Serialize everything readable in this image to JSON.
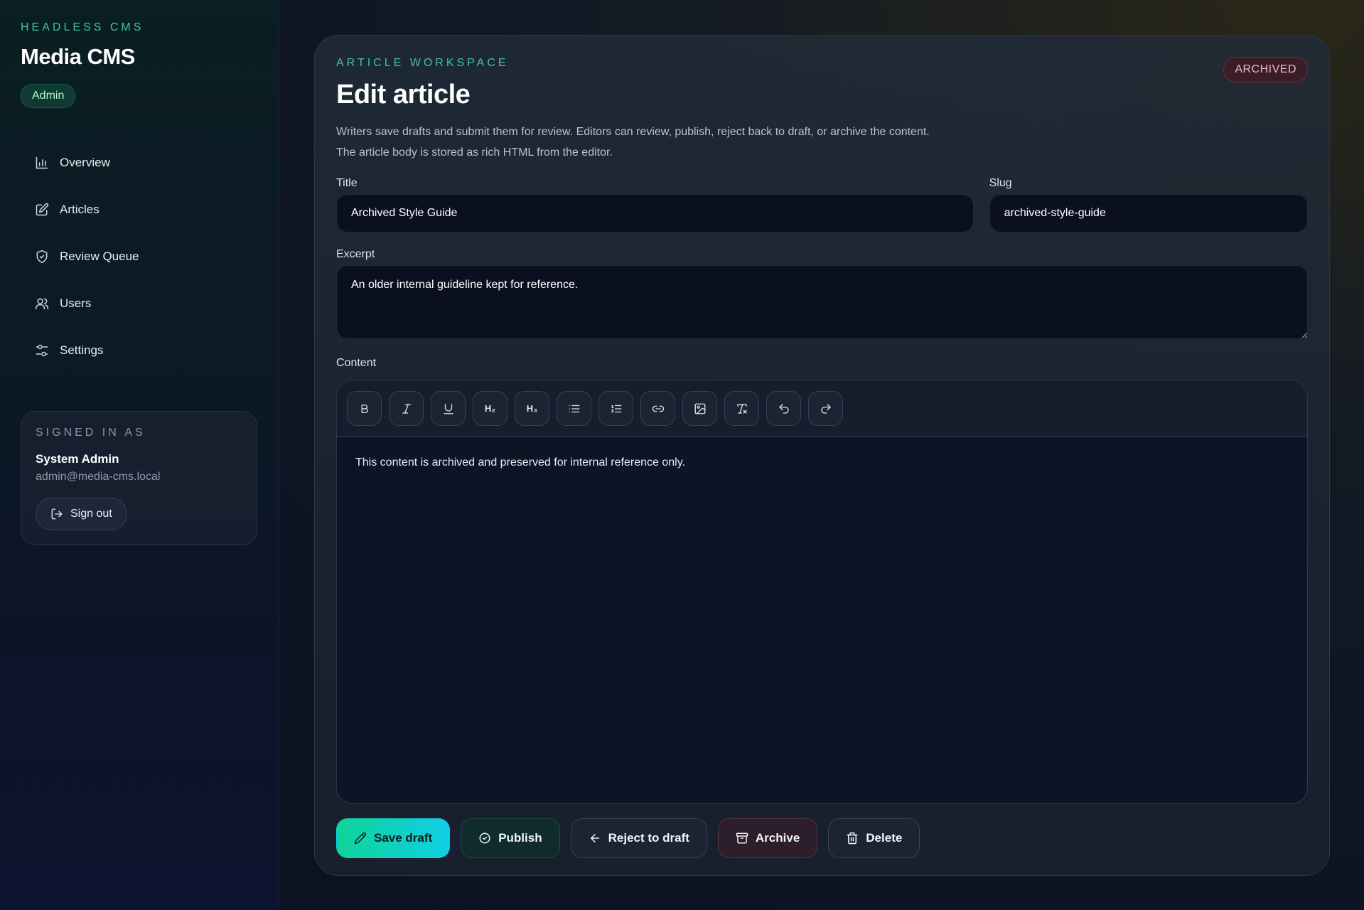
{
  "sidebar": {
    "eyebrow": "HEADLESS CMS",
    "brand": "Media CMS",
    "role": "Admin",
    "nav": [
      {
        "label": "Overview",
        "icon": "bar-chart-icon"
      },
      {
        "label": "Articles",
        "icon": "edit-icon"
      },
      {
        "label": "Review Queue",
        "icon": "shield-check-icon"
      },
      {
        "label": "Users",
        "icon": "users-icon"
      },
      {
        "label": "Settings",
        "icon": "sliders-icon"
      }
    ],
    "user": {
      "eyebrow": "SIGNED IN AS",
      "name": "System Admin",
      "email": "admin@media-cms.local",
      "signout_label": "Sign out"
    }
  },
  "main": {
    "eyebrow": "ARTICLE WORKSPACE",
    "title": "Edit article",
    "status": "ARCHIVED",
    "description": "Writers save drafts and submit them for review. Editors can review, publish, reject back to draft, or archive the content. The article body is stored as rich HTML from the editor.",
    "fields": {
      "title_label": "Title",
      "title_value": "Archived Style Guide",
      "slug_label": "Slug",
      "slug_value": "archived-style-guide",
      "excerpt_label": "Excerpt",
      "excerpt_value": "An older internal guideline kept for reference.",
      "content_label": "Content"
    },
    "toolbar": {
      "h2": "H₂",
      "h3": "H₃"
    },
    "content_body": "This content is archived and preserved for internal reference only.",
    "actions": {
      "save": "Save draft",
      "publish": "Publish",
      "reject": "Reject to draft",
      "archive": "Archive",
      "delete": "Delete"
    }
  },
  "colors": {
    "accent": "#3fc59a",
    "save_gradient_start": "#0fd39a",
    "save_gradient_end": "#11cfe6",
    "archived_badge": "#f4b9c0"
  }
}
